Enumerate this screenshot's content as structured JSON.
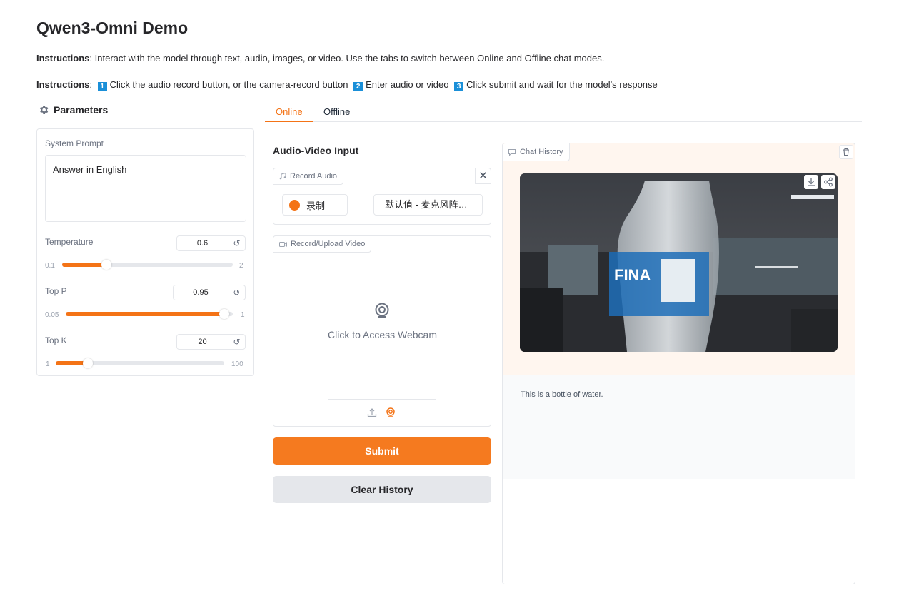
{
  "page": {
    "title": "Qwen3-Omni Demo",
    "instructions1_label": "Instructions",
    "instructions1_text": ": Interact with the model through text, audio, images, or video. Use the tabs to switch between Online and Offline chat modes.",
    "instructions2_label": "Instructions",
    "instructions2_sep": ":",
    "steps": [
      {
        "num": "1",
        "text": "Click the audio record button, or the camera-record button"
      },
      {
        "num": "2",
        "text": "Enter audio or video"
      },
      {
        "num": "3",
        "text": "Click submit and wait for the model's response"
      }
    ]
  },
  "parameters": {
    "heading": "Parameters",
    "system_prompt_label": "System Prompt",
    "system_prompt_value": "Answer in English",
    "temperature": {
      "label": "Temperature",
      "value": "0.6",
      "min": "0.1",
      "max": "2",
      "fraction": 0.26
    },
    "top_p": {
      "label": "Top P",
      "value": "0.95",
      "min": "0.05",
      "max": "1",
      "fraction": 0.95
    },
    "top_k": {
      "label": "Top K",
      "value": "20",
      "min": "1",
      "max": "100",
      "fraction": 0.19
    }
  },
  "tabs": [
    {
      "label": "Online",
      "active": true
    },
    {
      "label": "Offline",
      "active": false
    }
  ],
  "input": {
    "section_title": "Audio-Video Input",
    "record_audio_tag": "Record Audio",
    "record_button": "录制",
    "mic_select": "默认值 - 麦克风阵列 (适用于数字麦克风的英特尔® 智音技术)",
    "video_tag": "Record/Upload Video",
    "webcam_text": "Click to Access Webcam"
  },
  "buttons": {
    "submit": "Submit",
    "clear": "Clear History"
  },
  "chat": {
    "tag": "Chat History",
    "bot_message": "This is a bottle of water."
  },
  "colors": {
    "accent": "#f47316",
    "badge": "#1a8fd8"
  }
}
